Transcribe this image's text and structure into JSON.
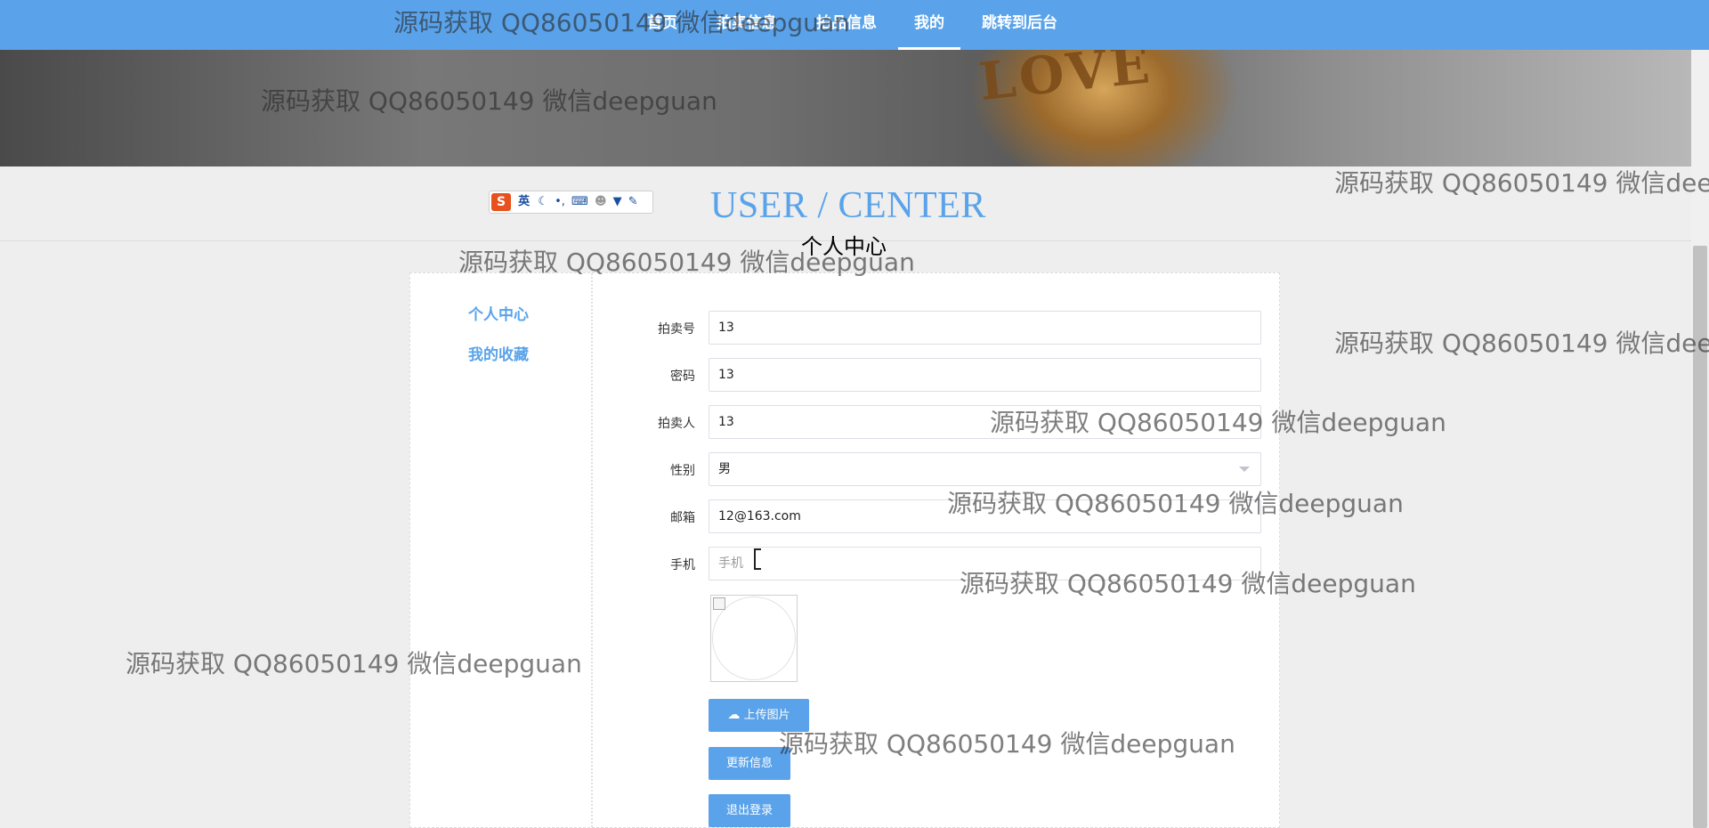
{
  "nav": {
    "items": [
      {
        "label": "首页"
      },
      {
        "label": "拍卖信息"
      },
      {
        "label": "拍品信息"
      },
      {
        "label": "我的"
      },
      {
        "label": "跳转到后台"
      }
    ],
    "active_index": 3,
    "background_color": "#5aa3ea"
  },
  "banner": {
    "image_text": "LOVE"
  },
  "ime_toolbar": {
    "logo": "S",
    "mode": "英"
  },
  "page_header": {
    "title_en": "USER / CENTER",
    "title_zh": "个人中心"
  },
  "sidebar": {
    "items": [
      {
        "label": "个人中心"
      },
      {
        "label": "我的收藏"
      }
    ]
  },
  "form": {
    "fields": [
      {
        "label": "拍卖号",
        "value": "13"
      },
      {
        "label": "密码",
        "value": "13"
      },
      {
        "label": "拍卖人",
        "value": "13"
      },
      {
        "label": "性别",
        "value": "男"
      },
      {
        "label": "邮箱",
        "value": "12@163.com"
      },
      {
        "label": "手机",
        "placeholder": "手机"
      }
    ],
    "upload_button": "上传图片",
    "update_button": "更新信息",
    "logout_button": "退出登录"
  },
  "watermark_text": "源码获取 QQ86050149 微信deepguan",
  "accent_color": "#5aa3ea"
}
